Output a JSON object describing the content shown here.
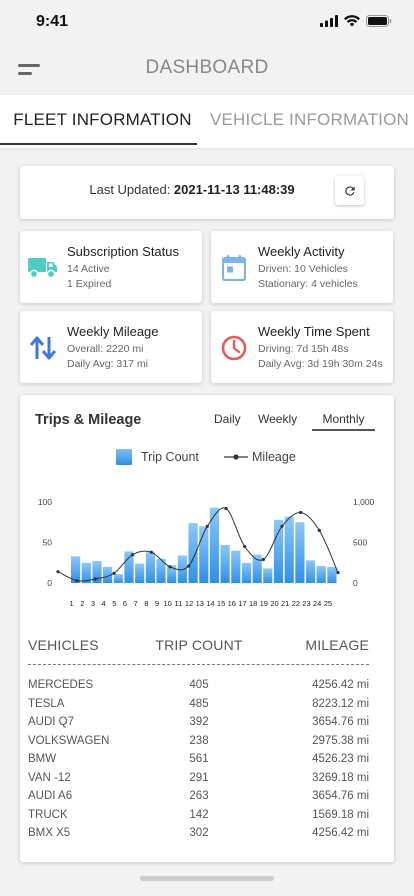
{
  "status_bar": {
    "time": "9:41"
  },
  "header": {
    "title": "DASHBOARD"
  },
  "tabs": [
    {
      "label": "FLEET INFORMATION",
      "active": true
    },
    {
      "label": "VEHICLE INFORMATION",
      "active": false
    }
  ],
  "update": {
    "label": "Last Updated: ",
    "value": "2021-11-13 11:48:39"
  },
  "stats": {
    "subscription": {
      "title": "Subscription Status",
      "line1": "14 Active",
      "line2": "1 Expired",
      "icon": "truck-icon",
      "color": "#4ecdc4"
    },
    "activity": {
      "title": "Weekly Activity",
      "line1": "Driven: 10 Vehicles",
      "line2": "Stationary: 4 vehicles",
      "icon": "calendar-icon",
      "color": "#7eb2e8"
    },
    "mileage": {
      "title": "Weekly Mileage",
      "line1": "Overall: 2220 mi",
      "line2": "Daily Avg: 317 mi",
      "icon": "swap-arrows-icon",
      "color": "#3d7ad6"
    },
    "time_spent": {
      "title": "Weekly Time Spent",
      "line1": "Driving: 7d 15h 48s",
      "line2": "Daily Avg: 3d 19h 30m 24s",
      "icon": "clock-icon",
      "color": "#e35d5d"
    }
  },
  "trips": {
    "title": "Trips & Mileage",
    "periods": [
      "Daily",
      "Weekly",
      "Monthly"
    ],
    "active_period": "Monthly",
    "legend": {
      "bars": "Trip Count",
      "line": "Mileage"
    }
  },
  "chart_data": {
    "type": "bar",
    "categories": [
      "1",
      "2",
      "3",
      "4",
      "5",
      "6",
      "7",
      "8",
      "9",
      "10",
      "11",
      "12",
      "13",
      "14",
      "15",
      "16",
      "17",
      "18",
      "19",
      "20",
      "21",
      "22",
      "23",
      "24",
      "25"
    ],
    "series": [
      {
        "name": "Trip Count",
        "type": "bar",
        "axis": "left",
        "values": [
          33,
          25,
          27,
          20,
          11,
          39,
          24,
          38,
          30,
          22,
          34,
          74,
          70,
          93,
          47,
          40,
          25,
          35,
          18,
          78,
          82,
          75,
          28,
          21,
          20
        ]
      },
      {
        "name": "Mileage",
        "type": "line",
        "axis": "right",
        "values": [
          140,
          30,
          50,
          120,
          350,
          380,
          200,
          210,
          700,
          920,
          450,
          290,
          700,
          870,
          650,
          130
        ]
      }
    ],
    "left_axis": {
      "ticks": [
        "0",
        "50",
        "100"
      ],
      "range": [
        0,
        100
      ]
    },
    "right_axis": {
      "ticks": [
        "0",
        "500",
        "1,000"
      ],
      "range": [
        0,
        1000
      ]
    },
    "bar_color": "#2f8fe6",
    "line_color": "#333333"
  },
  "table": {
    "headers": [
      "VEHICLES",
      "TRIP COUNT",
      "MILEAGE"
    ],
    "rows": [
      {
        "vehicle": "MERCEDES",
        "trips": "405",
        "mileage": "4256.42 mi"
      },
      {
        "vehicle": "TESLA",
        "trips": "485",
        "mileage": "8223.12 mi"
      },
      {
        "vehicle": "AUDI Q7",
        "trips": "392",
        "mileage": "3654.76 mi"
      },
      {
        "vehicle": "VOLKSWAGEN",
        "trips": "238",
        "mileage": "2975.38 mi"
      },
      {
        "vehicle": "BMW",
        "trips": "561",
        "mileage": "4526.23 mi"
      },
      {
        "vehicle": "VAN -12",
        "trips": "291",
        "mileage": "3269.18 mi"
      },
      {
        "vehicle": "AUDI A6",
        "trips": "263",
        "mileage": "3654.76 mi"
      },
      {
        "vehicle": "TRUCK",
        "trips": "142",
        "mileage": "1569.18 mi"
      },
      {
        "vehicle": "BMX X5",
        "trips": "302",
        "mileage": "4256.42 mi"
      }
    ]
  }
}
